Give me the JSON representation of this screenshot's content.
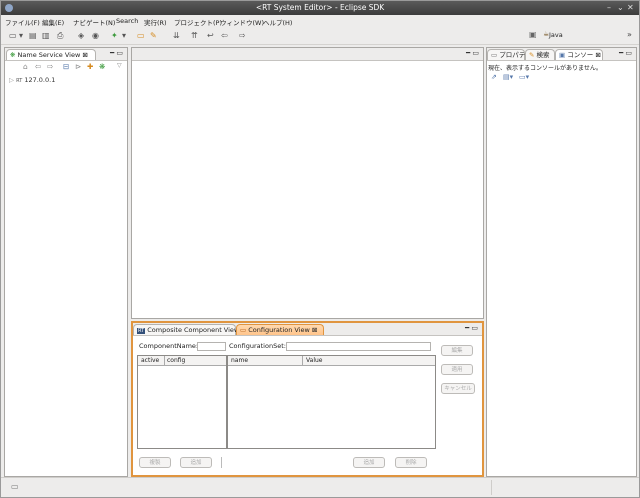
{
  "window": {
    "title": "<RT System Editor> - Eclipse SDK"
  },
  "menubar": {
    "items": [
      "ファイル(F)",
      "編集(E)",
      "ナビゲート(N)",
      "Search",
      "実行(R)",
      "プロジェクト(P)",
      "ウィンドウ(W)",
      "ヘルプ(H)"
    ]
  },
  "perspective": {
    "label": "Java",
    "overflow": "»"
  },
  "name_service_view": {
    "tab_label": "Name Service View",
    "close": "⊠",
    "tree": [
      {
        "badge": "RT",
        "label": "127.0.0.1"
      }
    ]
  },
  "right_panel": {
    "tabs": [
      "プロパテ",
      "検索",
      "コンソー"
    ],
    "close": "⊠",
    "message": "現在、表示するコンソールがありません。"
  },
  "bottom_panel": {
    "tabs": [
      "Composite Component View",
      "Configuration View"
    ],
    "close": "⊠",
    "component_name_label": "ComponentName:",
    "component_name_value": "",
    "configuration_set_label": "ConfigurationSet:",
    "configuration_set_value": "",
    "left_table": {
      "columns": [
        "active",
        "config"
      ]
    },
    "right_table": {
      "columns": [
        "name",
        "Value"
      ]
    },
    "side_buttons": [
      "編集",
      "適用",
      "キャンセル"
    ],
    "bottom_left_buttons": [
      "複製",
      "追加"
    ],
    "bottom_right_buttons": [
      "追加",
      "削除"
    ]
  },
  "icons": {
    "app": "eclipse-icon",
    "minimize": "minimize-icon",
    "maximize": "maximize-icon",
    "close": "close-icon"
  }
}
